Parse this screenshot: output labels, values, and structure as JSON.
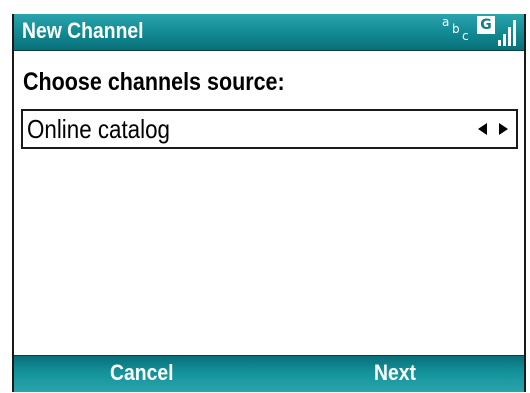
{
  "titlebar": {
    "title": "New Channel",
    "input_mode": {
      "a": "a",
      "b": "b",
      "c": "c"
    },
    "network": "G",
    "icons": [
      "input-mode-abc-icon",
      "network-g-icon",
      "signal-strength-icon"
    ]
  },
  "content": {
    "prompt": "Choose channels source:",
    "source_selector": {
      "value": "Online catalog"
    }
  },
  "softkeys": {
    "left": "Cancel",
    "right": "Next"
  },
  "colors": {
    "bar": "#118892",
    "bar_light": "#2aa4ad",
    "bar_dark": "#0a6f78",
    "text": "#000000",
    "background": "#ffffff"
  }
}
